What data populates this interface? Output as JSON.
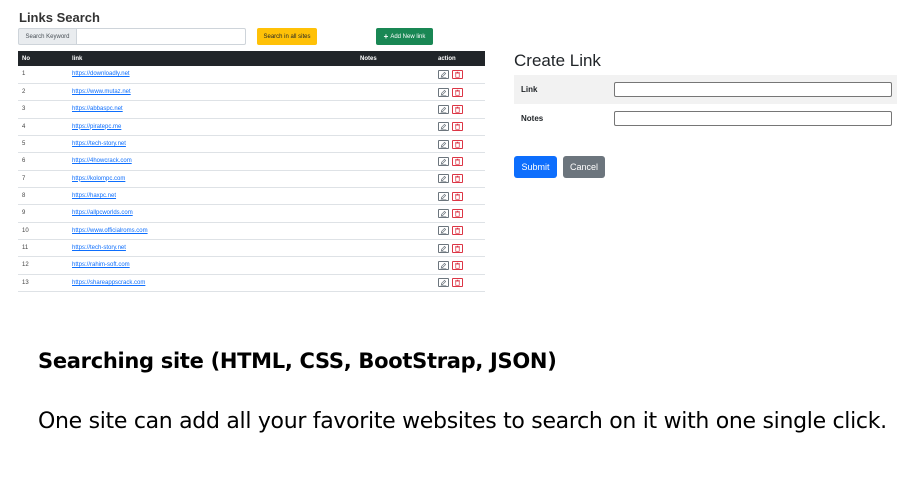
{
  "links_search": {
    "title": "Links Search",
    "search_label": "Search Keyword",
    "search_value": "",
    "search_button": "Search in all sites",
    "add_button": "Add New link",
    "table": {
      "headers": [
        "No",
        "link",
        "Notes",
        "action"
      ],
      "rows": [
        {
          "no": "1",
          "link": "https://downloadly.net",
          "notes": ""
        },
        {
          "no": "2",
          "link": "https://www.mutaz.net",
          "notes": ""
        },
        {
          "no": "3",
          "link": "https://abbaspc.net",
          "notes": ""
        },
        {
          "no": "4",
          "link": "https://piratepc.me",
          "notes": ""
        },
        {
          "no": "5",
          "link": "https://tech-story.net",
          "notes": ""
        },
        {
          "no": "6",
          "link": "https://4howcrack.com",
          "notes": ""
        },
        {
          "no": "7",
          "link": "https://kolompc.com",
          "notes": ""
        },
        {
          "no": "8",
          "link": "https://haxpc.net",
          "notes": ""
        },
        {
          "no": "9",
          "link": "https://allpcworlds.com",
          "notes": ""
        },
        {
          "no": "10",
          "link": "https://www.officialroms.com",
          "notes": ""
        },
        {
          "no": "11",
          "link": "https://tech-story.net",
          "notes": ""
        },
        {
          "no": "12",
          "link": "https://rahim-soft.com",
          "notes": ""
        },
        {
          "no": "13",
          "link": "https://shareappscrack.com",
          "notes": ""
        }
      ]
    }
  },
  "create_link": {
    "title": "Create Link",
    "link_label": "Link",
    "link_value": "",
    "notes_label": "Notes",
    "notes_value": "",
    "submit_button": "Submit",
    "cancel_button": "Cancel"
  },
  "caption": {
    "heading": "Searching site (HTML, CSS, BootStrap, JSON)",
    "text": "One site can add all your favorite websites to search on it with one single click."
  },
  "colors": {
    "search_button": "#ffc107",
    "add_button": "#198754",
    "table_header": "#212529",
    "link": "#0d6efd",
    "submit": "#0d6efd",
    "cancel": "#6c757d",
    "delete_icon": "#dc3545"
  },
  "icons": {
    "add": "plus-icon",
    "edit": "edit-icon",
    "delete": "trash-icon"
  }
}
